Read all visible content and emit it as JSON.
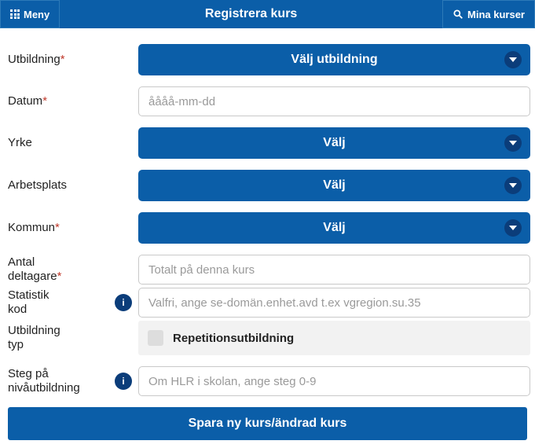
{
  "header": {
    "menu_label": "Meny",
    "title": "Registrera kurs",
    "right_label": "Mina kurser"
  },
  "fields": {
    "utbildning": {
      "label": "Utbildning",
      "required": true,
      "select_label": "Välj utbildning"
    },
    "datum": {
      "label": "Datum",
      "required": true,
      "placeholder": "åååå-mm-dd",
      "value": ""
    },
    "yrke": {
      "label": "Yrke",
      "required": false,
      "select_label": "Välj"
    },
    "arbetsplats": {
      "label": "Arbetsplats",
      "required": false,
      "select_label": "Välj"
    },
    "kommun": {
      "label": "Kommun",
      "required": true,
      "select_label": "Välj"
    },
    "antal": {
      "label_line1": "Antal",
      "label_line2": "deltagare",
      "required": true,
      "placeholder": "Totalt på denna kurs",
      "value": ""
    },
    "statistik": {
      "label_line1": "Statistik",
      "label_line2": "kod",
      "placeholder": "Valfri, ange se-domän.enhet.avd t.ex vgregion.su.35",
      "value": ""
    },
    "utbildning_typ": {
      "label_line1": "Utbildning",
      "label_line2": "typ",
      "checkbox_label": "Repetitionsutbildning",
      "checked": false
    },
    "steg": {
      "label_line1": "Steg på",
      "label_line2": "nivåutbildning",
      "placeholder": "Om HLR i skolan, ange steg 0-9",
      "value": ""
    }
  },
  "submit_label": "Spara ny kurs/ändrad kurs",
  "required_marker": "*",
  "info_glyph": "i"
}
